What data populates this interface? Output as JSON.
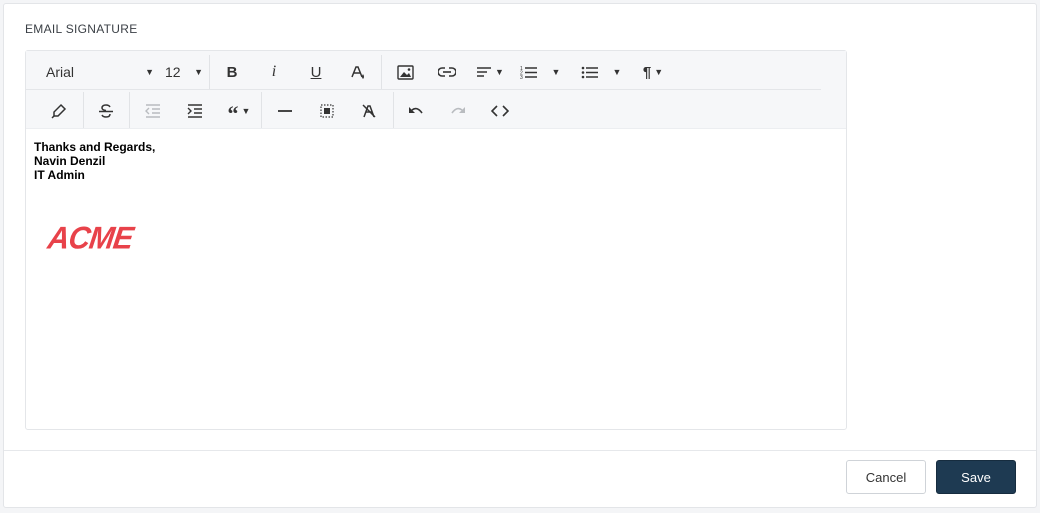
{
  "section": {
    "title": "EMAIL SIGNATURE"
  },
  "toolbar": {
    "font_family": "Arial",
    "font_size": "12",
    "icons": [
      "bold-icon",
      "italic-icon",
      "underline-icon",
      "font-color-icon",
      "image-icon",
      "link-icon",
      "align-icon",
      "ordered-list-icon",
      "unordered-list-icon",
      "paragraph-icon",
      "highlight-icon",
      "strikethrough-icon",
      "outdent-icon",
      "indent-icon",
      "quote-icon",
      "horizontal-rule-icon",
      "select-all-icon",
      "clear-format-icon",
      "undo-icon",
      "redo-icon",
      "code-view-icon"
    ]
  },
  "content": {
    "lines": [
      "Thanks and Regards,",
      "Navin Denzil",
      "IT Admin"
    ],
    "logo_text": "ACME",
    "logo_color": "#e8424a"
  },
  "actions": {
    "cancel_label": "Cancel",
    "save_label": "Save",
    "save_color": "#1e3a52"
  }
}
